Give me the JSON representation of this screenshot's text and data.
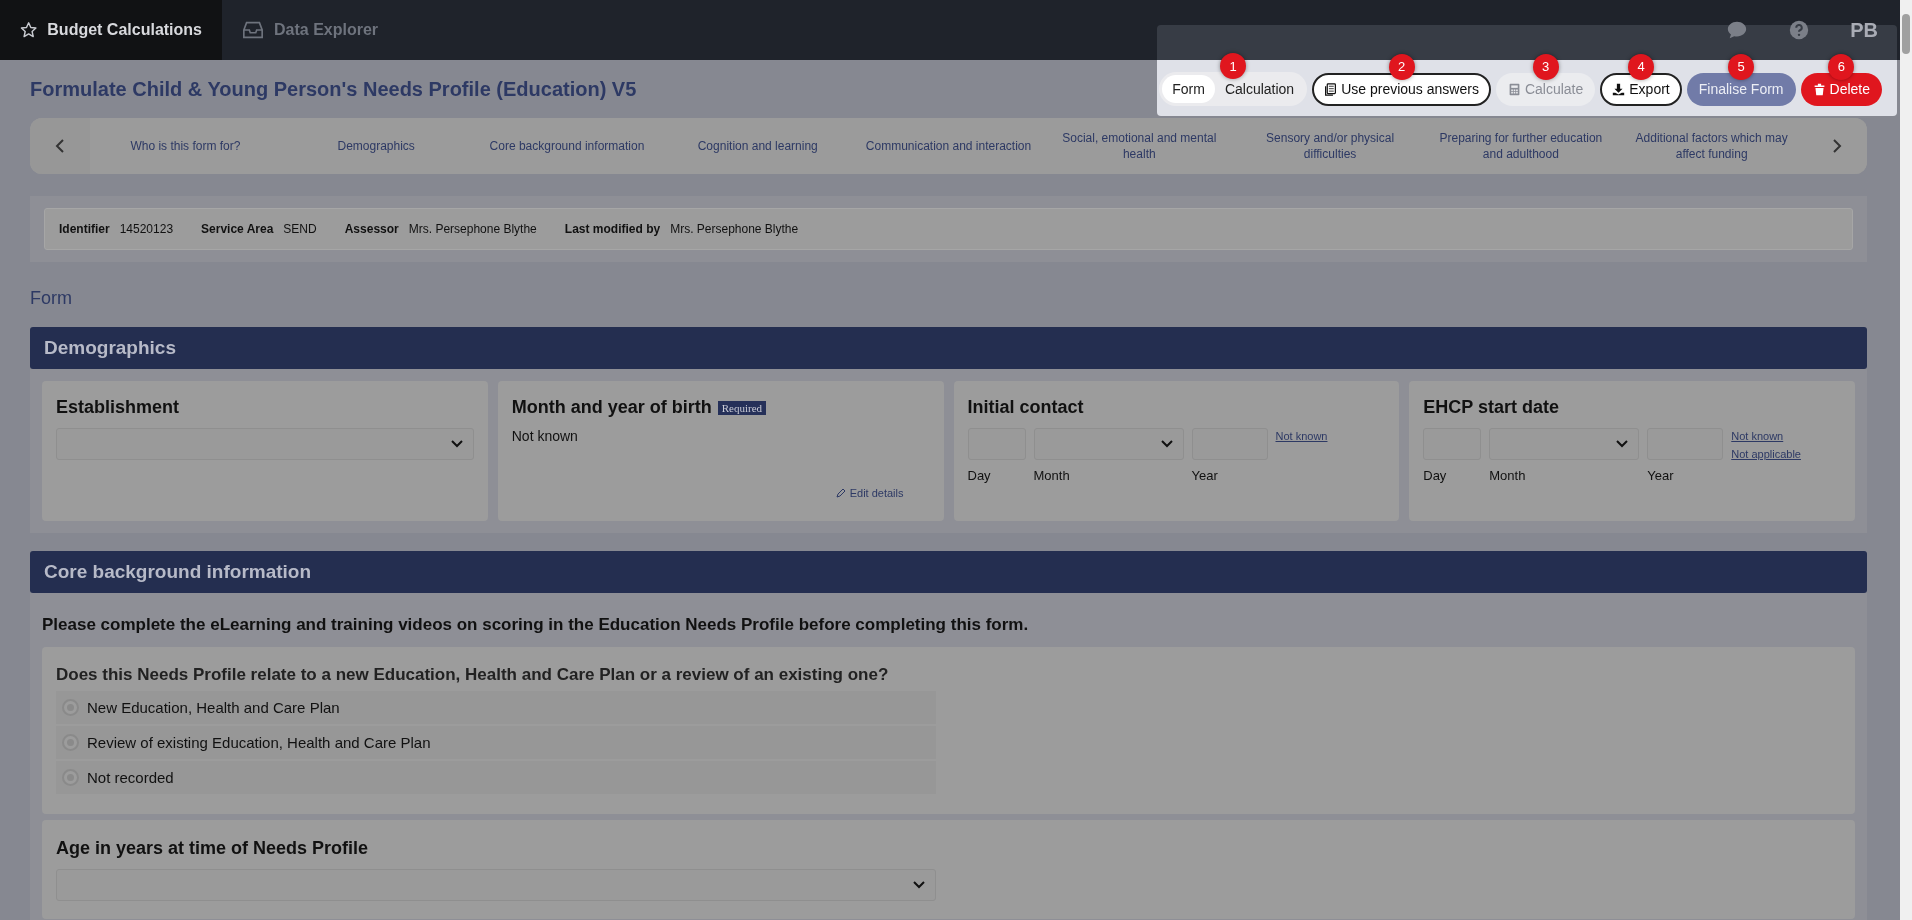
{
  "top_nav": {
    "tabs": [
      {
        "label": "Budget Calculations",
        "selected": true
      },
      {
        "label": "Data Explorer",
        "selected": false
      }
    ],
    "user_initials": "PB"
  },
  "page_title": "Formulate Child & Young Person's Needs Profile (Education) V5",
  "view_toggle": {
    "step": "1",
    "options": [
      {
        "label": "Form",
        "selected": true
      },
      {
        "label": "Calculation",
        "selected": false
      }
    ]
  },
  "actions": [
    {
      "label": "Use previous answers",
      "kind": "outline",
      "step": "2"
    },
    {
      "label": "Calculate",
      "kind": "disabled",
      "step": "3"
    },
    {
      "label": "Export",
      "kind": "outline",
      "step": "4"
    },
    {
      "label": "Finalise Form",
      "kind": "muted",
      "step": "5"
    },
    {
      "label": "Delete",
      "kind": "danger",
      "step": "6"
    }
  ],
  "section_nav": {
    "items": [
      "Who is this form for?",
      "Demographics",
      "Core background information",
      "Cognition and learning",
      "Communication and interaction",
      "Social, emotional and mental health",
      "Sensory and/or physical difficulties",
      "Preparing for further education and adulthood",
      "Additional factors which may affect funding"
    ]
  },
  "record_info": [
    {
      "label": "Identifier",
      "value": "14520123"
    },
    {
      "label": "Service Area",
      "value": "SEND"
    },
    {
      "label": "Assessor",
      "value": "Mrs. Persephone Blythe"
    },
    {
      "label": "Last modified by",
      "value": "Mrs. Persephone Blythe"
    }
  ],
  "form_heading": "Form",
  "sections": [
    {
      "title": "Demographics",
      "kind": "cards",
      "fields": [
        {
          "kind": "select",
          "label": "Establishment"
        },
        {
          "kind": "readonly",
          "label": "Month and year of birth",
          "badge": "Required",
          "value": "Not known",
          "link": "Edit details"
        },
        {
          "kind": "date",
          "label": "Initial contact",
          "parts": [
            "Day",
            "Month",
            "Year"
          ],
          "links": [
            "Not known"
          ]
        },
        {
          "kind": "date",
          "label": "EHCP start date",
          "parts": [
            "Day",
            "Month",
            "Year"
          ],
          "links": [
            "Not known",
            "Not applicable"
          ]
        }
      ]
    },
    {
      "title": "Core background information",
      "kind": "questions",
      "note": "Please complete the eLearning and training videos on scoring in the Education Needs Profile before completing this form.",
      "fields": [
        {
          "kind": "radio",
          "label": "Does this Needs Profile relate to a new Education, Health and Care Plan or a review of an existing one?",
          "options": [
            {
              "label": "New Education, Health and Care Plan",
              "selected": false
            },
            {
              "label": "Review of existing Education, Health and Care Plan",
              "selected": false
            },
            {
              "label": "Not recorded",
              "selected": false
            }
          ]
        },
        {
          "kind": "select",
          "label": "Age in years at time of Needs Profile"
        }
      ]
    }
  ]
}
